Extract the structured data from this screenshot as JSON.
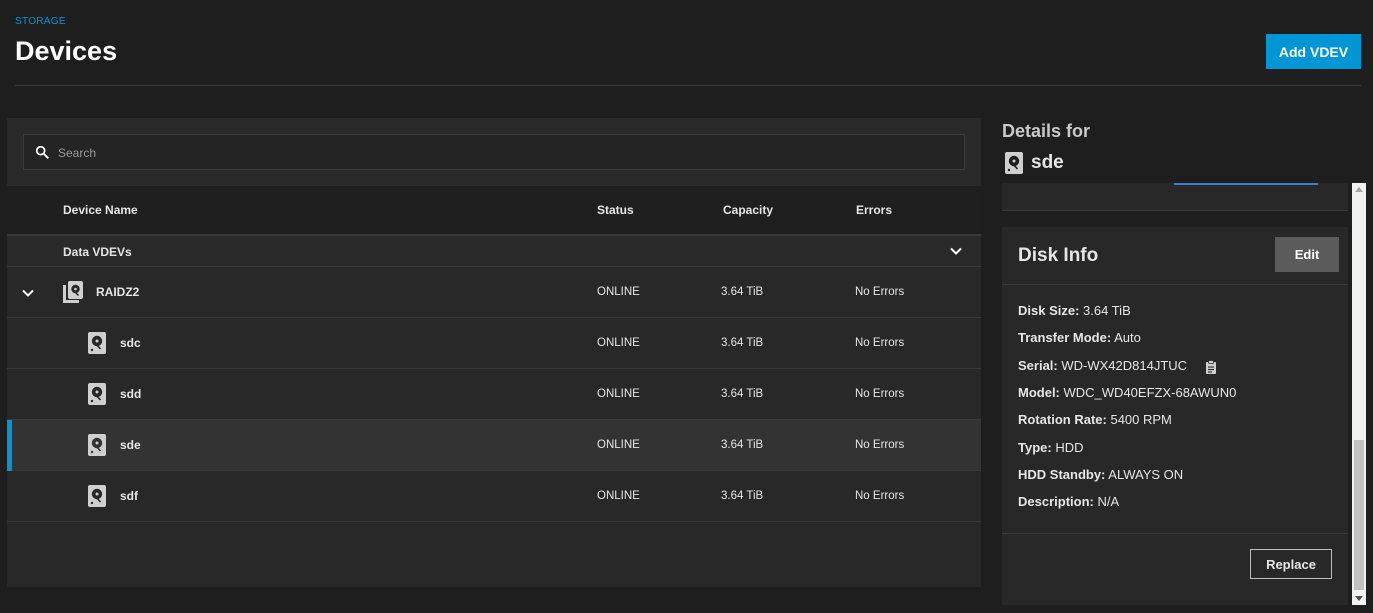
{
  "header": {
    "breadcrumb": "STORAGE",
    "title": "Devices",
    "add_vdev_label": "Add VDEV"
  },
  "search": {
    "placeholder": "Search",
    "value": ""
  },
  "table": {
    "columns": [
      "Device Name",
      "Status",
      "Capacity",
      "Errors"
    ],
    "group_label": "Data VDEVs",
    "rows": [
      {
        "name": "RAIDZ2",
        "status": "ONLINE",
        "capacity": "3.64 TiB",
        "errors": "No Errors"
      },
      {
        "name": "sdc",
        "status": "ONLINE",
        "capacity": "3.64 TiB",
        "errors": "No Errors"
      },
      {
        "name": "sdd",
        "status": "ONLINE",
        "capacity": "3.64 TiB",
        "errors": "No Errors"
      },
      {
        "name": "sde",
        "status": "ONLINE",
        "capacity": "3.64 TiB",
        "errors": "No Errors"
      },
      {
        "name": "sdf",
        "status": "ONLINE",
        "capacity": "3.64 TiB",
        "errors": "No Errors"
      }
    ]
  },
  "details": {
    "title": "Details for",
    "device": "sde",
    "disk_info": {
      "title": "Disk Info",
      "edit_label": "Edit",
      "replace_label": "Replace",
      "fields": [
        {
          "label": "Disk Size:",
          "value": "3.64 TiB"
        },
        {
          "label": "Transfer Mode:",
          "value": "Auto"
        },
        {
          "label": "Serial:",
          "value": "WD-WX42D814JTUC"
        },
        {
          "label": "Model:",
          "value": "WDC_WD40EFZX-68AWUN0"
        },
        {
          "label": "Rotation Rate:",
          "value": "5400 RPM"
        },
        {
          "label": "Type:",
          "value": "HDD"
        },
        {
          "label": "HDD Standby:",
          "value": "ALWAYS ON"
        },
        {
          "label": "Description:",
          "value": "N/A"
        }
      ]
    }
  },
  "colors": {
    "accent": "#0095d5",
    "background": "#1e1e1e",
    "panel": "#282828"
  },
  "icons": {
    "search": "search-icon",
    "disk": "hard-disk-icon",
    "vdev": "vdev-stack-icon",
    "clipboard": "clipboard-icon",
    "chevron": "chevron-down-icon"
  }
}
